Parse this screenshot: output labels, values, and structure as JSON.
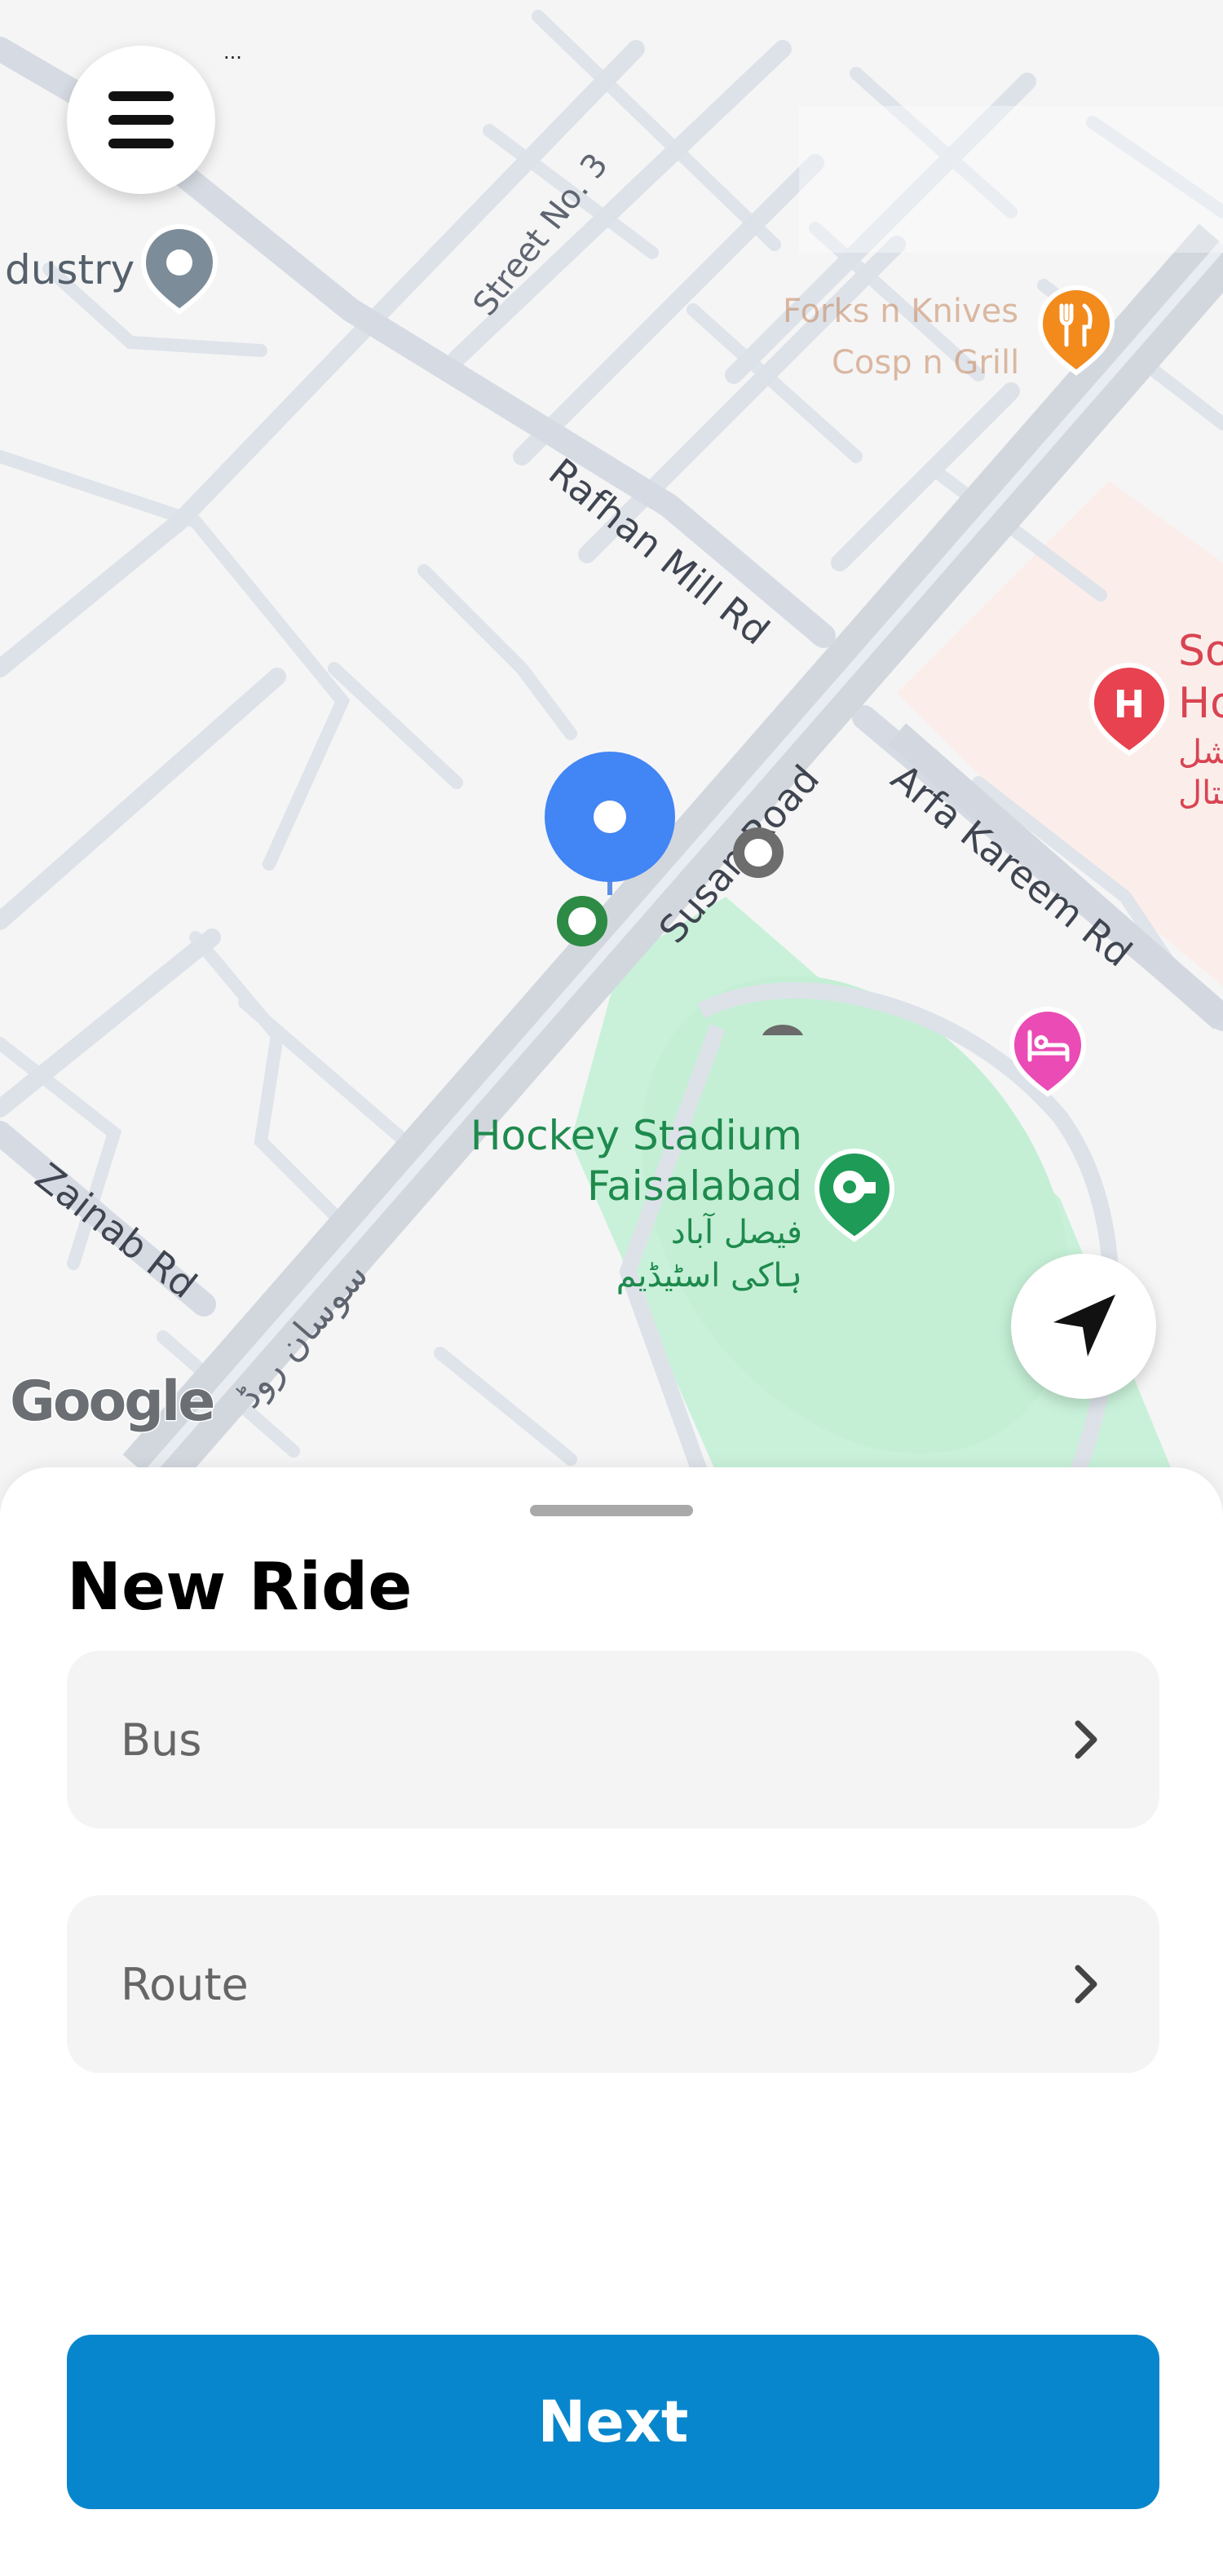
{
  "map": {
    "provider_logo": "Google",
    "street_labels": {
      "street_no_3": "Street No. 3",
      "rafhan_mill_rd": "Rafhan Mill Rd",
      "susan_road": "Susan Road",
      "arfa_kareem_rd": "Arfa Kareem Rd",
      "zainab_rd": "Zainab Rd",
      "susan_road_urdu": "سوسان روڈ"
    },
    "poi_labels": {
      "industry": "dustry",
      "restaurant_line1": "Forks n Knives",
      "restaurant_line2": "Cosp n Grill",
      "stadium_line1": "Hockey Stadium",
      "stadium_line2": "Faisalabad",
      "stadium_urdu_line1": "فیصل آباد",
      "stadium_urdu_line2": "ہاکی اسٹیڈیم",
      "hospital_line1": "So",
      "hospital_line2": "Ho",
      "hospital_urdu_line1": "شل",
      "hospital_urdu_line2": "ںتال"
    },
    "ellipsis": "..."
  },
  "sheet": {
    "title": "New Ride",
    "bus_label": "Bus",
    "route_label": "Route",
    "next_label": "Next"
  },
  "colors": {
    "primary": "#0786cd",
    "user_location": "#4285f4",
    "park": "#c9f1d9",
    "hospital": "#e8414f",
    "restaurant": "#f28a1c",
    "hotel": "#ea4bb4"
  },
  "icons": {
    "menu": "hamburger-icon",
    "locate": "navigation-arrow-icon",
    "chevron": "chevron-right-icon"
  }
}
